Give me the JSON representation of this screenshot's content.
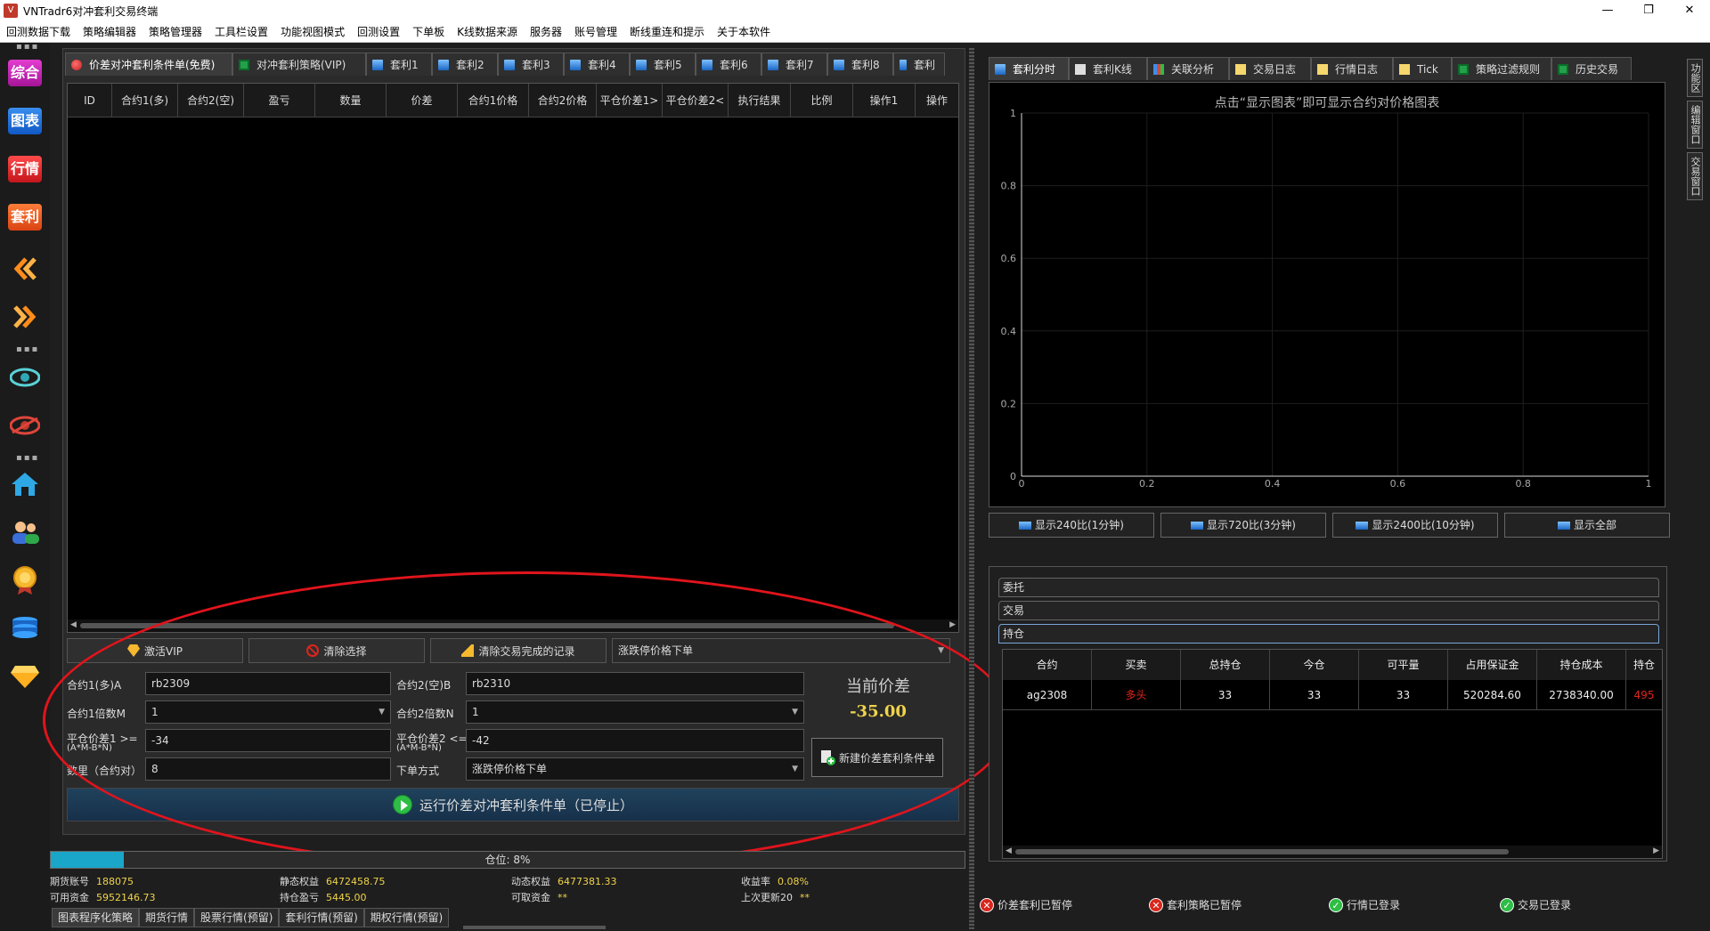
{
  "window": {
    "title": "VNTradr6对冲套利交易终端",
    "controls": {
      "minimize": "—",
      "maximize": "❐",
      "close": "✕"
    }
  },
  "menu": [
    "回测数据下载",
    "策略编辑器",
    "策略管理器",
    "工具栏设置",
    "功能视图模式",
    "回测设置",
    "下单板",
    "K线数据来源",
    "服务器",
    "账号管理",
    "断线重连和提示",
    "关于本软件"
  ],
  "left_toolbar": [
    "综合",
    "图表",
    "行情",
    "套利"
  ],
  "left_tabs": [
    "价差对冲套利条件单(免费)",
    "对冲套利策略(VIP)",
    "套利1",
    "套利2",
    "套利3",
    "套利4",
    "套利5",
    "套利6",
    "套利7",
    "套利8",
    "套利"
  ],
  "table_headers": [
    "ID",
    "合约1(多)",
    "合约2(空)",
    "盈亏",
    "数量",
    "价差",
    "合约1价格",
    "合约2价格",
    "平仓价差1>",
    "平仓价差2<",
    "执行结果",
    "比例",
    "操作1",
    "操作"
  ],
  "buttons": {
    "activate_vip": "激活VIP",
    "clear_selection": "清除选择",
    "clear_completed": "清除交易完成的记录",
    "order_mode_top": "涨跌停价格下单",
    "new_condition": "新建价差套利条件单",
    "run": "运行价差对冲套利条件单（已停止）"
  },
  "form": {
    "contract1_label": "合约1(多)A",
    "contract1_value": "rb2309",
    "contract2_label": "合约2(空)B",
    "contract2_value": "rb2310",
    "mult1_label": "合约1倍数M",
    "mult1_value": "1",
    "mult2_label": "合约2倍数N",
    "mult2_value": "1",
    "close1_label": "平仓价差1 >=",
    "close1_sub": "(A*M-B*N)",
    "close1_value": "-34",
    "close2_label": "平仓价差2 <=",
    "close2_sub": "(A*M-B*N)",
    "close2_value": "-42",
    "qty_label": "数里（合约对）",
    "qty_value": "8",
    "order_label": "下单方式",
    "order_value": "涨跌停价格下单",
    "current_spread_label": "当前价差",
    "current_spread_value": "-35.00"
  },
  "progress": {
    "text": "仓位: 8%",
    "value": 0.08
  },
  "account": {
    "futures_account_label": "期货账号",
    "futures_account_value": "188075",
    "available_label": "可用资金",
    "available_value": "5952146.73",
    "static_equity_label": "静态权益",
    "static_equity_value": "6472458.75",
    "position_pnl_label": "持仓盈亏",
    "position_pnl_value": "5445.00",
    "dynamic_equity_label": "动态权益",
    "dynamic_equity_value": "6477381.33",
    "withdrawable_label": "可取资金",
    "withdrawable_value": "**",
    "return_label": "收益率",
    "return_value": "0.08%",
    "last_update_label": "上次更新20",
    "last_update_value": "**"
  },
  "bottom_tabs": [
    "图表程序化策略",
    "期货行情",
    "股票行情(预留)",
    "套利行情(预留)",
    "期权行情(预留)"
  ],
  "right_tabs": [
    "套利分时",
    "套利K线",
    "关联分析",
    "交易日志",
    "行情日志",
    "Tick",
    "策略过滤规则",
    "历史交易"
  ],
  "chart": {
    "title": "点击“显示图表”即可显示合约对价格图表",
    "y_ticks": [
      "1",
      "0.8",
      "0.6",
      "0.4",
      "0.2",
      "0"
    ],
    "x_ticks": [
      "0",
      "0.2",
      "0.4",
      "0.6",
      "0.8",
      "1"
    ]
  },
  "chart_data": {
    "type": "line",
    "title": "点击“显示图表”即可显示合约对价格图表",
    "xlim": [
      0,
      1
    ],
    "ylim": [
      0,
      1
    ],
    "x_ticks": [
      0,
      0.2,
      0.4,
      0.6,
      0.8,
      1
    ],
    "y_ticks": [
      0,
      0.2,
      0.4,
      0.6,
      0.8,
      1
    ],
    "series": [],
    "grid": true
  },
  "chart_buttons": [
    "显示240比(1分钟)",
    "显示720比(3分钟)",
    "显示2400比(10分钟)",
    "显示全部"
  ],
  "sub_tabs": [
    "委托",
    "交易",
    "持仓"
  ],
  "position_headers": [
    "合约",
    "买卖",
    "总持仓",
    "今仓",
    "可平量",
    "占用保证金",
    "持仓成本",
    "持仓"
  ],
  "positions": [
    {
      "contract": "ag2308",
      "side": "多头",
      "total": "33",
      "today": "33",
      "closable": "33",
      "margin": "520284.60",
      "cost": "2738340.00",
      "extra": "495"
    }
  ],
  "status": {
    "spread_paused": "价差套利已暂停",
    "strategy_paused": "套利策略已暂停",
    "market_logged": "行情已登录",
    "trade_logged": "交易已登录"
  },
  "right_vtabs": [
    "功能区",
    "编辑窗口",
    "交易窗口"
  ]
}
